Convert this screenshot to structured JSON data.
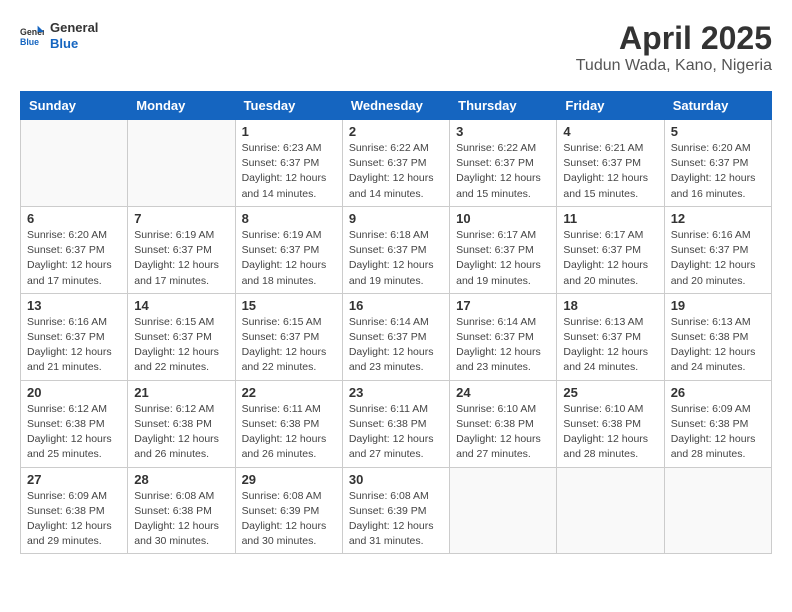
{
  "header": {
    "logo_general": "General",
    "logo_blue": "Blue",
    "month": "April 2025",
    "location": "Tudun Wada, Kano, Nigeria"
  },
  "days_of_week": [
    "Sunday",
    "Monday",
    "Tuesday",
    "Wednesday",
    "Thursday",
    "Friday",
    "Saturday"
  ],
  "weeks": [
    [
      {
        "day": "",
        "info": ""
      },
      {
        "day": "",
        "info": ""
      },
      {
        "day": "1",
        "info": "Sunrise: 6:23 AM\nSunset: 6:37 PM\nDaylight: 12 hours and 14 minutes."
      },
      {
        "day": "2",
        "info": "Sunrise: 6:22 AM\nSunset: 6:37 PM\nDaylight: 12 hours and 14 minutes."
      },
      {
        "day": "3",
        "info": "Sunrise: 6:22 AM\nSunset: 6:37 PM\nDaylight: 12 hours and 15 minutes."
      },
      {
        "day": "4",
        "info": "Sunrise: 6:21 AM\nSunset: 6:37 PM\nDaylight: 12 hours and 15 minutes."
      },
      {
        "day": "5",
        "info": "Sunrise: 6:20 AM\nSunset: 6:37 PM\nDaylight: 12 hours and 16 minutes."
      }
    ],
    [
      {
        "day": "6",
        "info": "Sunrise: 6:20 AM\nSunset: 6:37 PM\nDaylight: 12 hours and 17 minutes."
      },
      {
        "day": "7",
        "info": "Sunrise: 6:19 AM\nSunset: 6:37 PM\nDaylight: 12 hours and 17 minutes."
      },
      {
        "day": "8",
        "info": "Sunrise: 6:19 AM\nSunset: 6:37 PM\nDaylight: 12 hours and 18 minutes."
      },
      {
        "day": "9",
        "info": "Sunrise: 6:18 AM\nSunset: 6:37 PM\nDaylight: 12 hours and 19 minutes."
      },
      {
        "day": "10",
        "info": "Sunrise: 6:17 AM\nSunset: 6:37 PM\nDaylight: 12 hours and 19 minutes."
      },
      {
        "day": "11",
        "info": "Sunrise: 6:17 AM\nSunset: 6:37 PM\nDaylight: 12 hours and 20 minutes."
      },
      {
        "day": "12",
        "info": "Sunrise: 6:16 AM\nSunset: 6:37 PM\nDaylight: 12 hours and 20 minutes."
      }
    ],
    [
      {
        "day": "13",
        "info": "Sunrise: 6:16 AM\nSunset: 6:37 PM\nDaylight: 12 hours and 21 minutes."
      },
      {
        "day": "14",
        "info": "Sunrise: 6:15 AM\nSunset: 6:37 PM\nDaylight: 12 hours and 22 minutes."
      },
      {
        "day": "15",
        "info": "Sunrise: 6:15 AM\nSunset: 6:37 PM\nDaylight: 12 hours and 22 minutes."
      },
      {
        "day": "16",
        "info": "Sunrise: 6:14 AM\nSunset: 6:37 PM\nDaylight: 12 hours and 23 minutes."
      },
      {
        "day": "17",
        "info": "Sunrise: 6:14 AM\nSunset: 6:37 PM\nDaylight: 12 hours and 23 minutes."
      },
      {
        "day": "18",
        "info": "Sunrise: 6:13 AM\nSunset: 6:37 PM\nDaylight: 12 hours and 24 minutes."
      },
      {
        "day": "19",
        "info": "Sunrise: 6:13 AM\nSunset: 6:38 PM\nDaylight: 12 hours and 24 minutes."
      }
    ],
    [
      {
        "day": "20",
        "info": "Sunrise: 6:12 AM\nSunset: 6:38 PM\nDaylight: 12 hours and 25 minutes."
      },
      {
        "day": "21",
        "info": "Sunrise: 6:12 AM\nSunset: 6:38 PM\nDaylight: 12 hours and 26 minutes."
      },
      {
        "day": "22",
        "info": "Sunrise: 6:11 AM\nSunset: 6:38 PM\nDaylight: 12 hours and 26 minutes."
      },
      {
        "day": "23",
        "info": "Sunrise: 6:11 AM\nSunset: 6:38 PM\nDaylight: 12 hours and 27 minutes."
      },
      {
        "day": "24",
        "info": "Sunrise: 6:10 AM\nSunset: 6:38 PM\nDaylight: 12 hours and 27 minutes."
      },
      {
        "day": "25",
        "info": "Sunrise: 6:10 AM\nSunset: 6:38 PM\nDaylight: 12 hours and 28 minutes."
      },
      {
        "day": "26",
        "info": "Sunrise: 6:09 AM\nSunset: 6:38 PM\nDaylight: 12 hours and 28 minutes."
      }
    ],
    [
      {
        "day": "27",
        "info": "Sunrise: 6:09 AM\nSunset: 6:38 PM\nDaylight: 12 hours and 29 minutes."
      },
      {
        "day": "28",
        "info": "Sunrise: 6:08 AM\nSunset: 6:38 PM\nDaylight: 12 hours and 30 minutes."
      },
      {
        "day": "29",
        "info": "Sunrise: 6:08 AM\nSunset: 6:39 PM\nDaylight: 12 hours and 30 minutes."
      },
      {
        "day": "30",
        "info": "Sunrise: 6:08 AM\nSunset: 6:39 PM\nDaylight: 12 hours and 31 minutes."
      },
      {
        "day": "",
        "info": ""
      },
      {
        "day": "",
        "info": ""
      },
      {
        "day": "",
        "info": ""
      }
    ]
  ]
}
